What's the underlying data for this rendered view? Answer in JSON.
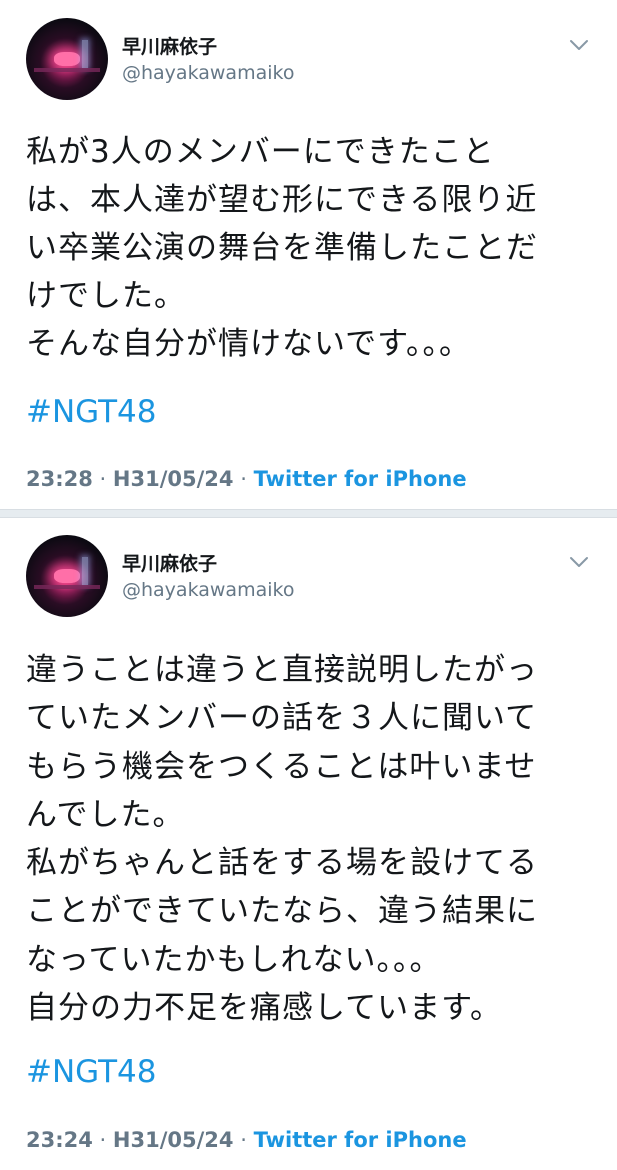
{
  "tweets": [
    {
      "display_name": "早川麻依子",
      "handle": "@hayakawamaiko",
      "text_lines": [
        "私が3人のメンバーにできたこと",
        "は、本人達が望む形にできる限り近",
        "い卒業公演の舞台を準備したことだ",
        "けでした。",
        "そんな自分が情けないです。。。"
      ],
      "hashtag": "#NGT48",
      "time": "23:28",
      "separator": "·",
      "date": "H31/05/24",
      "source": "Twitter for iPhone",
      "menu_icon": "chevron-down-icon"
    },
    {
      "display_name": "早川麻依子",
      "handle": "@hayakawamaiko",
      "text_lines": [
        "違うことは違うと直接説明したがっ",
        "ていたメンバーの話を３人に聞いて",
        "もらう機会をつくることは叶いませ",
        "んでした。",
        "私がちゃんと話をする場を設けてる",
        "ことができていたなら、違う結果に",
        "なっていたかもしれない。。。",
        "自分の力不足を痛感しています。"
      ],
      "hashtag": "#NGT48",
      "time": "23:24",
      "separator": "·",
      "date": "H31/05/24",
      "source": "Twitter for iPhone",
      "menu_icon": "chevron-down-icon"
    }
  ],
  "colors": {
    "text": "#14171a",
    "secondary": "#657786",
    "link": "#1b95e0",
    "divider": "#e6ecf0"
  }
}
